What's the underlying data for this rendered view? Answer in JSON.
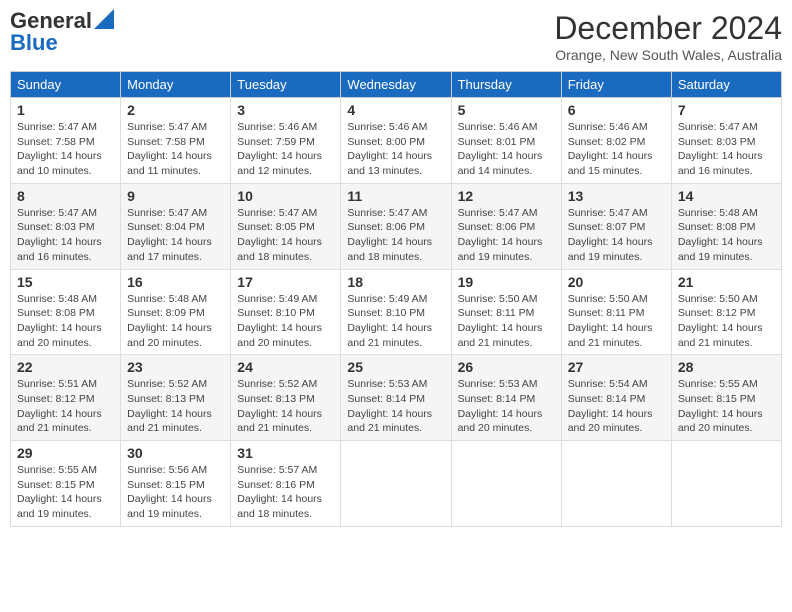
{
  "logo": {
    "general": "General",
    "blue": "Blue"
  },
  "header": {
    "month": "December 2024",
    "location": "Orange, New South Wales, Australia"
  },
  "weekdays": [
    "Sunday",
    "Monday",
    "Tuesday",
    "Wednesday",
    "Thursday",
    "Friday",
    "Saturday"
  ],
  "weeks": [
    [
      {
        "day": "1",
        "sunrise": "Sunrise: 5:47 AM",
        "sunset": "Sunset: 7:58 PM",
        "daylight": "Daylight: 14 hours and 10 minutes."
      },
      {
        "day": "2",
        "sunrise": "Sunrise: 5:47 AM",
        "sunset": "Sunset: 7:58 PM",
        "daylight": "Daylight: 14 hours and 11 minutes."
      },
      {
        "day": "3",
        "sunrise": "Sunrise: 5:46 AM",
        "sunset": "Sunset: 7:59 PM",
        "daylight": "Daylight: 14 hours and 12 minutes."
      },
      {
        "day": "4",
        "sunrise": "Sunrise: 5:46 AM",
        "sunset": "Sunset: 8:00 PM",
        "daylight": "Daylight: 14 hours and 13 minutes."
      },
      {
        "day": "5",
        "sunrise": "Sunrise: 5:46 AM",
        "sunset": "Sunset: 8:01 PM",
        "daylight": "Daylight: 14 hours and 14 minutes."
      },
      {
        "day": "6",
        "sunrise": "Sunrise: 5:46 AM",
        "sunset": "Sunset: 8:02 PM",
        "daylight": "Daylight: 14 hours and 15 minutes."
      },
      {
        "day": "7",
        "sunrise": "Sunrise: 5:47 AM",
        "sunset": "Sunset: 8:03 PM",
        "daylight": "Daylight: 14 hours and 16 minutes."
      }
    ],
    [
      {
        "day": "8",
        "sunrise": "Sunrise: 5:47 AM",
        "sunset": "Sunset: 8:03 PM",
        "daylight": "Daylight: 14 hours and 16 minutes."
      },
      {
        "day": "9",
        "sunrise": "Sunrise: 5:47 AM",
        "sunset": "Sunset: 8:04 PM",
        "daylight": "Daylight: 14 hours and 17 minutes."
      },
      {
        "day": "10",
        "sunrise": "Sunrise: 5:47 AM",
        "sunset": "Sunset: 8:05 PM",
        "daylight": "Daylight: 14 hours and 18 minutes."
      },
      {
        "day": "11",
        "sunrise": "Sunrise: 5:47 AM",
        "sunset": "Sunset: 8:06 PM",
        "daylight": "Daylight: 14 hours and 18 minutes."
      },
      {
        "day": "12",
        "sunrise": "Sunrise: 5:47 AM",
        "sunset": "Sunset: 8:06 PM",
        "daylight": "Daylight: 14 hours and 19 minutes."
      },
      {
        "day": "13",
        "sunrise": "Sunrise: 5:47 AM",
        "sunset": "Sunset: 8:07 PM",
        "daylight": "Daylight: 14 hours and 19 minutes."
      },
      {
        "day": "14",
        "sunrise": "Sunrise: 5:48 AM",
        "sunset": "Sunset: 8:08 PM",
        "daylight": "Daylight: 14 hours and 19 minutes."
      }
    ],
    [
      {
        "day": "15",
        "sunrise": "Sunrise: 5:48 AM",
        "sunset": "Sunset: 8:08 PM",
        "daylight": "Daylight: 14 hours and 20 minutes."
      },
      {
        "day": "16",
        "sunrise": "Sunrise: 5:48 AM",
        "sunset": "Sunset: 8:09 PM",
        "daylight": "Daylight: 14 hours and 20 minutes."
      },
      {
        "day": "17",
        "sunrise": "Sunrise: 5:49 AM",
        "sunset": "Sunset: 8:10 PM",
        "daylight": "Daylight: 14 hours and 20 minutes."
      },
      {
        "day": "18",
        "sunrise": "Sunrise: 5:49 AM",
        "sunset": "Sunset: 8:10 PM",
        "daylight": "Daylight: 14 hours and 21 minutes."
      },
      {
        "day": "19",
        "sunrise": "Sunrise: 5:50 AM",
        "sunset": "Sunset: 8:11 PM",
        "daylight": "Daylight: 14 hours and 21 minutes."
      },
      {
        "day": "20",
        "sunrise": "Sunrise: 5:50 AM",
        "sunset": "Sunset: 8:11 PM",
        "daylight": "Daylight: 14 hours and 21 minutes."
      },
      {
        "day": "21",
        "sunrise": "Sunrise: 5:50 AM",
        "sunset": "Sunset: 8:12 PM",
        "daylight": "Daylight: 14 hours and 21 minutes."
      }
    ],
    [
      {
        "day": "22",
        "sunrise": "Sunrise: 5:51 AM",
        "sunset": "Sunset: 8:12 PM",
        "daylight": "Daylight: 14 hours and 21 minutes."
      },
      {
        "day": "23",
        "sunrise": "Sunrise: 5:52 AM",
        "sunset": "Sunset: 8:13 PM",
        "daylight": "Daylight: 14 hours and 21 minutes."
      },
      {
        "day": "24",
        "sunrise": "Sunrise: 5:52 AM",
        "sunset": "Sunset: 8:13 PM",
        "daylight": "Daylight: 14 hours and 21 minutes."
      },
      {
        "day": "25",
        "sunrise": "Sunrise: 5:53 AM",
        "sunset": "Sunset: 8:14 PM",
        "daylight": "Daylight: 14 hours and 21 minutes."
      },
      {
        "day": "26",
        "sunrise": "Sunrise: 5:53 AM",
        "sunset": "Sunset: 8:14 PM",
        "daylight": "Daylight: 14 hours and 20 minutes."
      },
      {
        "day": "27",
        "sunrise": "Sunrise: 5:54 AM",
        "sunset": "Sunset: 8:14 PM",
        "daylight": "Daylight: 14 hours and 20 minutes."
      },
      {
        "day": "28",
        "sunrise": "Sunrise: 5:55 AM",
        "sunset": "Sunset: 8:15 PM",
        "daylight": "Daylight: 14 hours and 20 minutes."
      }
    ],
    [
      {
        "day": "29",
        "sunrise": "Sunrise: 5:55 AM",
        "sunset": "Sunset: 8:15 PM",
        "daylight": "Daylight: 14 hours and 19 minutes."
      },
      {
        "day": "30",
        "sunrise": "Sunrise: 5:56 AM",
        "sunset": "Sunset: 8:15 PM",
        "daylight": "Daylight: 14 hours and 19 minutes."
      },
      {
        "day": "31",
        "sunrise": "Sunrise: 5:57 AM",
        "sunset": "Sunset: 8:16 PM",
        "daylight": "Daylight: 14 hours and 18 minutes."
      },
      null,
      null,
      null,
      null
    ]
  ]
}
